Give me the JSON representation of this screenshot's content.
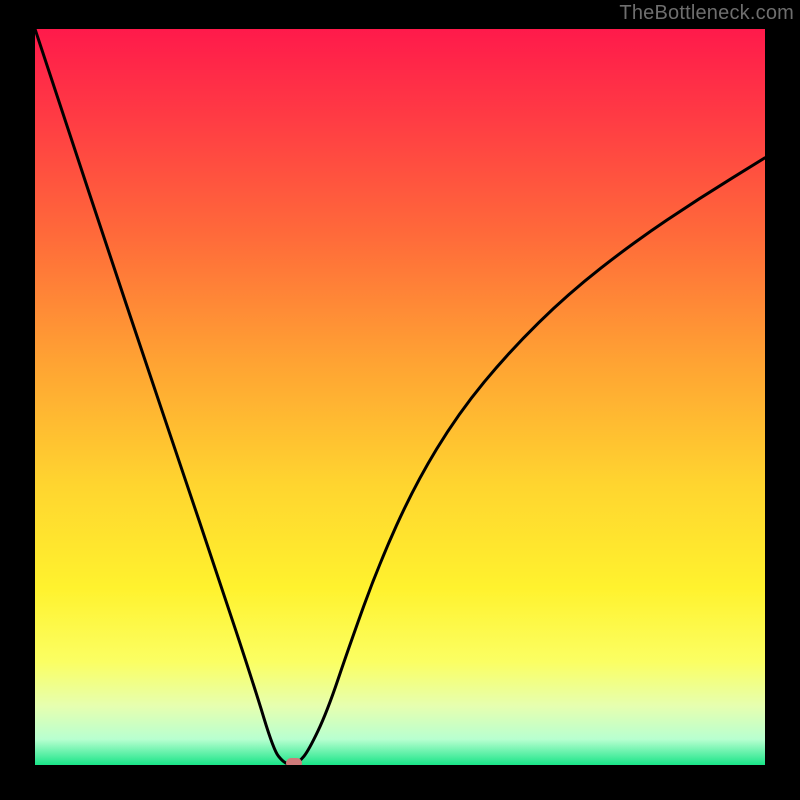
{
  "watermark": "TheBottleneck.com",
  "colors": {
    "black": "#000000",
    "curve": "#000000",
    "marker": "#cf7a7a",
    "gradient_stops": [
      {
        "offset": 0.0,
        "color": "#ff1a4b"
      },
      {
        "offset": 0.12,
        "color": "#ff3b44"
      },
      {
        "offset": 0.28,
        "color": "#ff6a3a"
      },
      {
        "offset": 0.45,
        "color": "#ffa233"
      },
      {
        "offset": 0.62,
        "color": "#ffd52f"
      },
      {
        "offset": 0.76,
        "color": "#fff22e"
      },
      {
        "offset": 0.86,
        "color": "#fbff63"
      },
      {
        "offset": 0.92,
        "color": "#e6ffb0"
      },
      {
        "offset": 0.965,
        "color": "#b8ffd0"
      },
      {
        "offset": 1.0,
        "color": "#19e588"
      }
    ]
  },
  "chart_data": {
    "type": "line",
    "title": "",
    "xlabel": "",
    "ylabel": "",
    "xlim": [
      0,
      1
    ],
    "ylim": [
      0,
      1
    ],
    "series": [
      {
        "name": "bottleneck-curve",
        "x": [
          0.0,
          0.05,
          0.1,
          0.15,
          0.2,
          0.25,
          0.3,
          0.327,
          0.34,
          0.35,
          0.362,
          0.375,
          0.4,
          0.43,
          0.47,
          0.52,
          0.58,
          0.65,
          0.73,
          0.82,
          0.91,
          1.0
        ],
        "y": [
          1.0,
          0.85,
          0.7,
          0.552,
          0.405,
          0.258,
          0.108,
          0.02,
          0.004,
          0.0,
          0.004,
          0.02,
          0.072,
          0.16,
          0.27,
          0.38,
          0.478,
          0.562,
          0.64,
          0.71,
          0.77,
          0.825
        ]
      }
    ],
    "marker": {
      "x": 0.355,
      "y": 0.0,
      "label": "optimal-point"
    },
    "grid": false,
    "legend": false
  }
}
